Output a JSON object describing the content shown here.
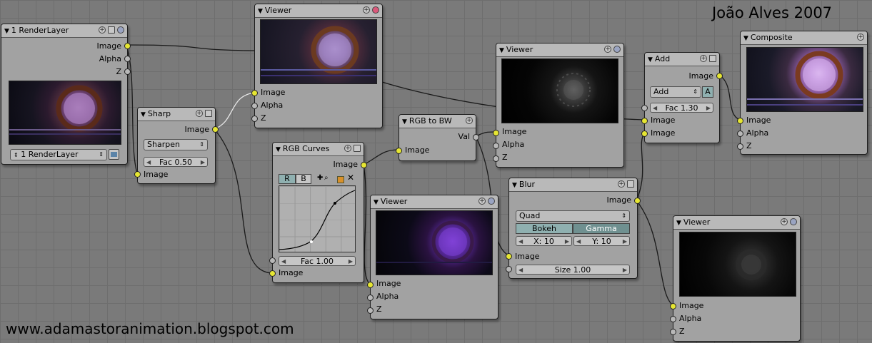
{
  "watermark": {
    "author": "João Alves 2007",
    "url": "www.adamastoranimation.blogspot.com"
  },
  "colors": {
    "background": "#7a7a7a",
    "node_body": "#a2a2a2",
    "socket_image": "#e6e633",
    "socket_value": "#b8b8b8",
    "toggle_active": "#8fb0b0"
  },
  "nodes": {
    "renderlayer": {
      "title": "1 RenderLayer",
      "outputs": [
        "Image",
        "Alpha",
        "Z"
      ],
      "layer_select": "1 RenderLayer"
    },
    "sharp": {
      "title": "Sharp",
      "output": "Image",
      "mode": "Sharpen",
      "fac": "Fac 0.50",
      "input": "Image"
    },
    "viewer1": {
      "title": "Viewer",
      "inputs": [
        "Image",
        "Alpha",
        "Z"
      ]
    },
    "rgbcurves": {
      "title": "RGB Curves",
      "output": "Image",
      "channel_r": "R",
      "channel_b": "B",
      "fac": "Fac 1.00",
      "input": "Image"
    },
    "rgbtobw": {
      "title": "RGB to BW",
      "output": "Val",
      "input": "Image"
    },
    "viewer2": {
      "title": "Viewer",
      "inputs": [
        "Image",
        "Alpha",
        "Z"
      ]
    },
    "viewer3": {
      "title": "Viewer",
      "inputs": [
        "Image",
        "Alpha",
        "Z"
      ]
    },
    "blur": {
      "title": "Blur",
      "output": "Image",
      "filter": "Quad",
      "bokeh": "Bokeh",
      "gamma": "Gamma",
      "x": "X: 10",
      "y": "Y: 10",
      "input": "Image",
      "size": "Size 1.00"
    },
    "add": {
      "title": "Add",
      "output": "Image",
      "blend": "Add",
      "alpha_toggle": "A",
      "fac": "Fac 1.30",
      "inputs": [
        "Image",
        "Image"
      ]
    },
    "composite": {
      "title": "Composite",
      "inputs": [
        "Image",
        "Alpha",
        "Z"
      ]
    },
    "viewer4": {
      "title": "Viewer",
      "inputs": [
        "Image",
        "Alpha",
        "Z"
      ]
    }
  }
}
